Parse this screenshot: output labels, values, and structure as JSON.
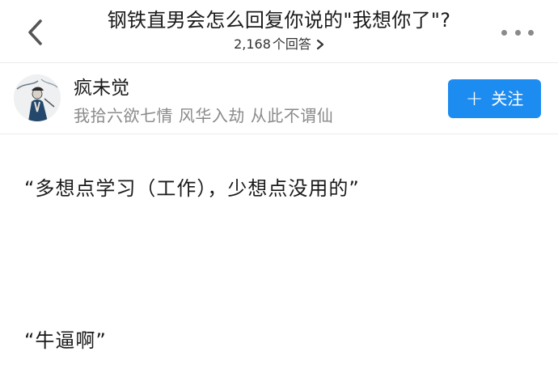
{
  "header": {
    "question_title": "钢铁直男会怎么回复你说的\"我想你了\"?",
    "answer_count": "2,168",
    "answer_suffix": "个回答"
  },
  "author": {
    "name": "疯未觉",
    "bio": "我拾六欲七情 风华入劫 从此不谓仙"
  },
  "follow_button": {
    "plus": "+",
    "label": "关注",
    "color": "#1d8cf0"
  },
  "answer": {
    "paragraphs": [
      "“多想点学习（工作），少想点没用的”",
      "“牛逼啊”"
    ]
  },
  "icons": [
    "back-arrow-icon",
    "chevron-right-icon",
    "more-dots-icon",
    "avatar"
  ]
}
